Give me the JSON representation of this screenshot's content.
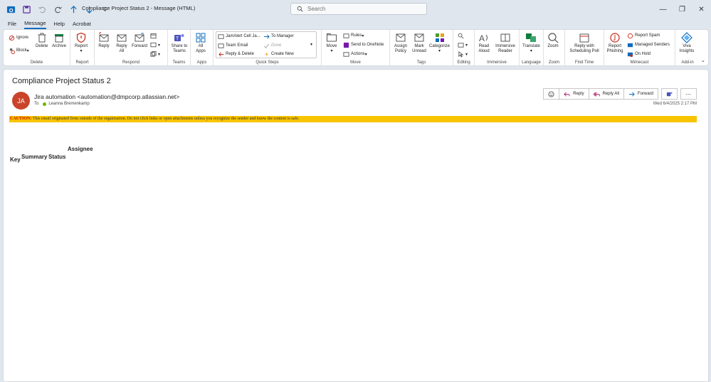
{
  "window": {
    "title": "Compliance Project Status 2  -  Message (HTML)",
    "search_placeholder": "Search"
  },
  "menu": {
    "tabs": [
      "File",
      "Message",
      "Help",
      "Acrobat"
    ],
    "active_tab": "Message"
  },
  "ribbon": {
    "delete_group": {
      "label": "Delete",
      "ignore": "Ignore",
      "block": "Block",
      "delete": "Delete",
      "archive": "Archive"
    },
    "report_group": {
      "label": "Report",
      "report": "Report"
    },
    "respond_group": {
      "label": "Respond",
      "reply": "Reply",
      "reply_all": "Reply All",
      "forward": "Forward"
    },
    "teams_group": {
      "label": "Teams",
      "share": "Share to Teams"
    },
    "apps_group": {
      "label": "Apps",
      "all_apps": "All Apps"
    },
    "quicksteps_group": {
      "label": "Quick Steps",
      "items": [
        "JamAlert Cell Ja...",
        "Team Email",
        "Reply & Delete",
        "To Manager",
        "Done",
        "Create New"
      ]
    },
    "move_group": {
      "label": "Move",
      "move": "Move",
      "rules": "Rules",
      "onenote": "Send to OneNote",
      "actions": "Actions"
    },
    "tags_group": {
      "label": "Tags",
      "assign_policy": "Assign Policy",
      "mark_unread": "Mark Unread",
      "categorize": "Categorize"
    },
    "editing_group": {
      "label": "Editing"
    },
    "immersive_group": {
      "label": "Immersive",
      "read_aloud": "Read Aloud",
      "immersive_reader": "Immersive Reader"
    },
    "language_group": {
      "label": "Language",
      "translate": "Translate"
    },
    "zoom_group": {
      "label": "Zoom",
      "zoom": "Zoom"
    },
    "findtime_group": {
      "label": "Find Time",
      "reply_poll": "Reply with Scheduling Poll"
    },
    "mimecast_group": {
      "label": "Mimecast",
      "report_phishing": "Report Phishing",
      "report_spam": "Report Spam",
      "managed_senders": "Managed Senders",
      "on_hold": "On Hold"
    },
    "addin_group": {
      "label": "Add-in",
      "viva": "Viva Insights"
    }
  },
  "message": {
    "subject": "Compliance Project Status 2",
    "avatar_initials": "JA",
    "sender": "Jira automation <automation@dmpcorp.atlassian.net>",
    "to_label": "To",
    "recipient": "Leanna Bremenkamp",
    "date": "Wed 6/4/2025 2:17 PM",
    "actions": {
      "reply": "Reply",
      "reply_all": "Reply All",
      "forward": "Forward"
    },
    "caution_prefix": "CAUTION:",
    "caution_text": " This email originated from outside of the organization. Do not click links or open attachments unless you recognize the sender and know the content is safe.",
    "table_headers": [
      "Key",
      "Summary",
      "Status",
      "Assignee"
    ]
  },
  "colors": {
    "accent": "#0f6cbd",
    "caution_bg": "#f8c400",
    "avatar": "#c9442a"
  }
}
